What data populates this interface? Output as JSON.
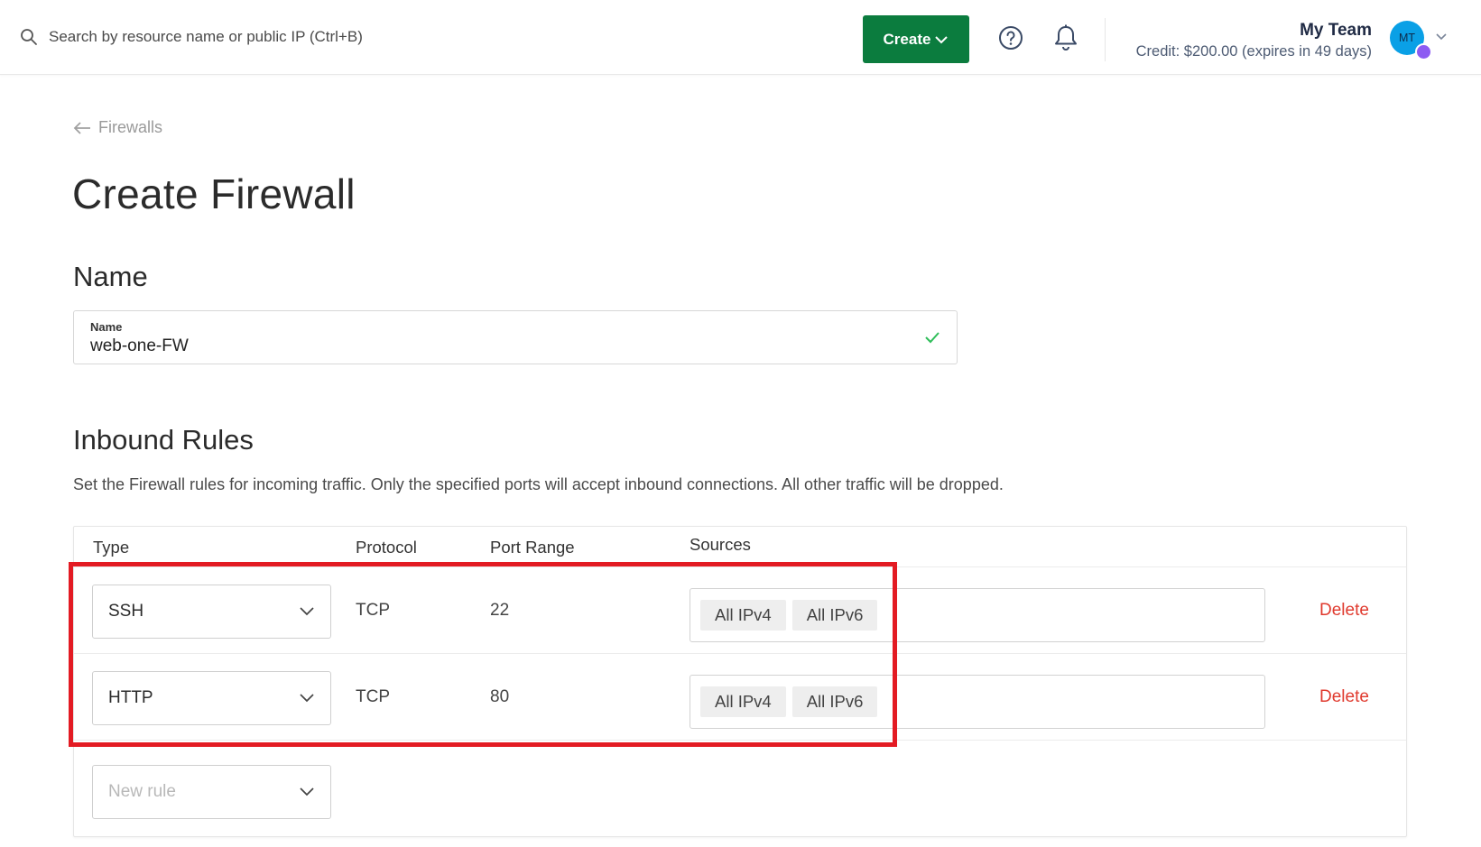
{
  "header": {
    "search_placeholder": "Search by resource name or public IP (Ctrl+B)",
    "create_label": "Create",
    "team_name": "My Team",
    "credit": "Credit: $200.00 (expires in 49 days)",
    "avatar_initials": "MT"
  },
  "breadcrumb": {
    "back_label": "Firewalls"
  },
  "page_title": "Create Firewall",
  "name_section": {
    "heading": "Name",
    "field_label": "Name",
    "field_value": "web-one-FW"
  },
  "inbound": {
    "heading": "Inbound Rules",
    "description": "Set the Firewall rules for incoming traffic. Only the specified ports will accept inbound connections. All other traffic will be dropped.",
    "columns": {
      "type": "Type",
      "protocol": "Protocol",
      "port_range": "Port Range",
      "sources": "Sources"
    },
    "rules": [
      {
        "type": "SSH",
        "protocol": "TCP",
        "port_range": "22",
        "sources": [
          "All IPv4",
          "All IPv6"
        ],
        "delete_label": "Delete"
      },
      {
        "type": "HTTP",
        "protocol": "TCP",
        "port_range": "80",
        "sources": [
          "All IPv4",
          "All IPv6"
        ],
        "delete_label": "Delete"
      }
    ],
    "new_rule_placeholder": "New rule"
  },
  "colors": {
    "brand_green": "#0b7c3e",
    "delete_red": "#e03a2e",
    "highlight_red": "#e31b23",
    "check_green": "#2ebd59",
    "avatar_blue": "#0aa0e6",
    "avatar_badge_purple": "#8d5cf2"
  },
  "icons": {
    "search": "search-icon",
    "help": "help-circle-icon",
    "notifications": "bell-icon",
    "back": "arrow-left-icon",
    "dropdown": "chevron-down-icon",
    "valid": "check-icon"
  }
}
